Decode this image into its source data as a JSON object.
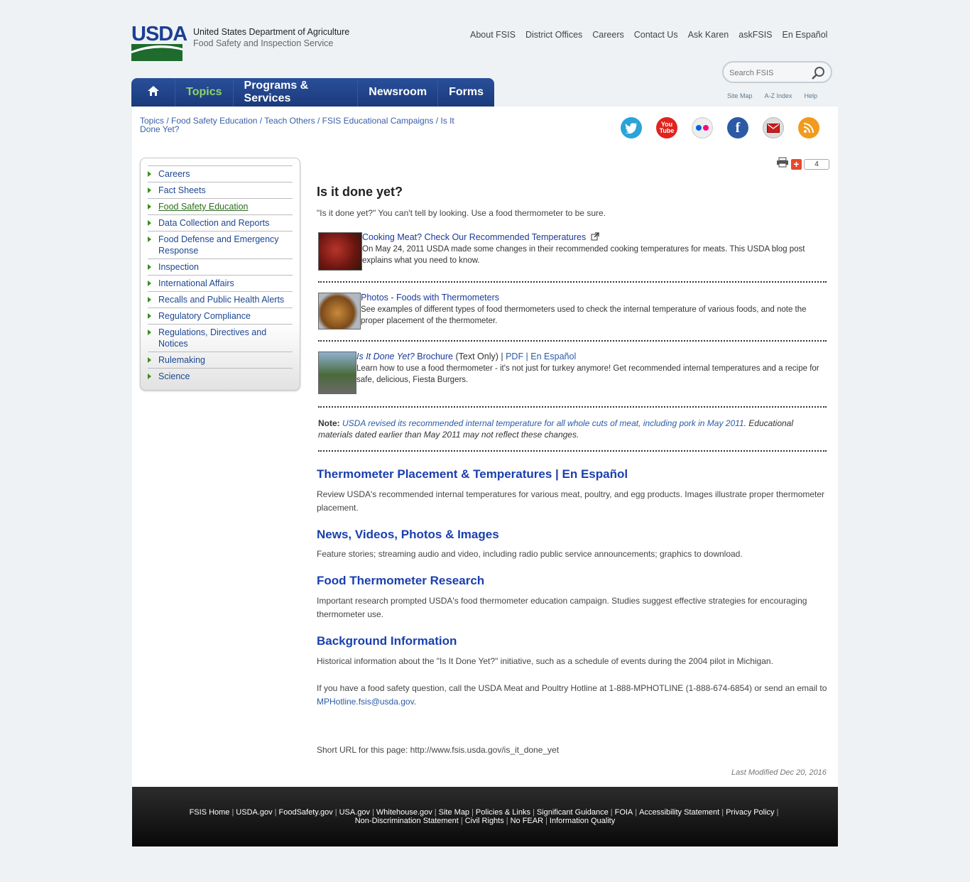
{
  "header": {
    "logo_text": "USDA",
    "agency_line1": "United States Department of Agriculture",
    "agency_line2": "Food Safety and Inspection Service",
    "top_links": [
      "About FSIS",
      "District Offices",
      "Careers",
      "Contact Us",
      "Ask Karen",
      "askFSIS",
      "En Español"
    ],
    "search_placeholder": "Search FSIS",
    "util_links": [
      "Site Map",
      "A-Z Index",
      "Help"
    ]
  },
  "navbar": {
    "items": [
      "Topics",
      "Programs & Services",
      "Newsroom",
      "Forms"
    ]
  },
  "breadcrumb": {
    "items": [
      "Topics",
      "Food Safety Education",
      "Teach Others",
      "FSIS Educational Campaigns"
    ],
    "current": "Is It Done Yet?"
  },
  "sidebar": {
    "items": [
      "Careers",
      "Fact Sheets",
      "Food Safety Education",
      "Data Collection and Reports",
      "Food Defense and Emergency Response",
      "Inspection",
      "International Affairs",
      "Recalls and Public Health Alerts",
      "Regulatory Compliance",
      "Regulations, Directives and Notices",
      "Rulemaking",
      "Science"
    ]
  },
  "tools": {
    "share_count": "4"
  },
  "main": {
    "title": "Is it done yet?",
    "intro": "\"Is it done yet?\" You can't tell by looking. Use a food thermometer to be sure.",
    "features": [
      {
        "title": "Cooking Meat? Check Our Recommended Temperatures",
        "desc": "On May 24, 2011 USDA made some changes in their recommended cooking temperatures for meats. This USDA blog post explains what you need to know."
      },
      {
        "title": "Photos - Foods with Thermometers",
        "desc": "See examples of different types of food thermometers used to check the internal temperature of various foods, and note the proper placement of the thermometer."
      },
      {
        "title_italic": "Is It Done Yet?",
        "title_rest": " Brochure",
        "text_only": " (Text Only) | ",
        "pdf": "PDF",
        "sep": " | ",
        "espanol": "En Español",
        "desc": "Learn how to use a food thermometer - it's not just for turkey anymore! Get recommended internal temperatures and a recipe for safe, delicious, Fiesta Burgers."
      }
    ],
    "note_label": "Note:",
    "note_link": "USDA revised its recommended internal temperature for all whole cuts of meat, including pork in May 2011",
    "note_rest": ". Educational materials dated earlier than May 2011 may not reflect these changes.",
    "sections": [
      {
        "heading": "Thermometer Placement & Temperatures | En Español",
        "text": "Review USDA's recommended internal temperatures for various meat, poultry, and egg products. Images illustrate proper thermometer placement."
      },
      {
        "heading": "News, Videos, Photos & Images",
        "text": "Feature stories; streaming audio and video, including radio public service announcements; graphics to download."
      },
      {
        "heading": "Food Thermometer Research",
        "text": "Important research prompted USDA's food thermometer education campaign. Studies suggest effective strategies for encouraging thermometer use."
      },
      {
        "heading": "Background Information",
        "text": "Historical information about the \"Is It Done Yet?\" initiative, such as a schedule of events during the 2004 pilot in Michigan."
      }
    ],
    "hotline_text": "If you have a food safety question, call the USDA Meat and Poultry Hotline at 1-888-MPHOTLINE (1-888-674-6854) or send an email to ",
    "hotline_email": "MPHotline.fsis@usda.gov",
    "hotline_end": ".",
    "short_url": "Short URL for this page: http://www.fsis.usda.gov/is_it_done_yet",
    "last_modified": "Last Modified Dec 20, 2016"
  },
  "footer": {
    "row1": [
      "FSIS Home",
      "USDA.gov",
      "FoodSafety.gov",
      "USA.gov",
      "Whitehouse.gov",
      "Site Map",
      "Policies & Links",
      "Significant Guidance",
      "FOIA",
      "Accessibility Statement",
      "Privacy Policy"
    ],
    "row2": [
      "Non-Discrimination Statement",
      "Civil Rights",
      "No FEAR",
      "Information Quality"
    ]
  },
  "colors": {
    "nav_blue": "#1a3a7a",
    "topics_green": "#8fd36a",
    "link_blue": "#1a3fae",
    "usda_green": "#1e6b2d"
  },
  "social_icons": [
    "twitter-icon",
    "youtube-icon",
    "flickr-icon",
    "facebook-icon",
    "email-icon",
    "rss-icon"
  ]
}
